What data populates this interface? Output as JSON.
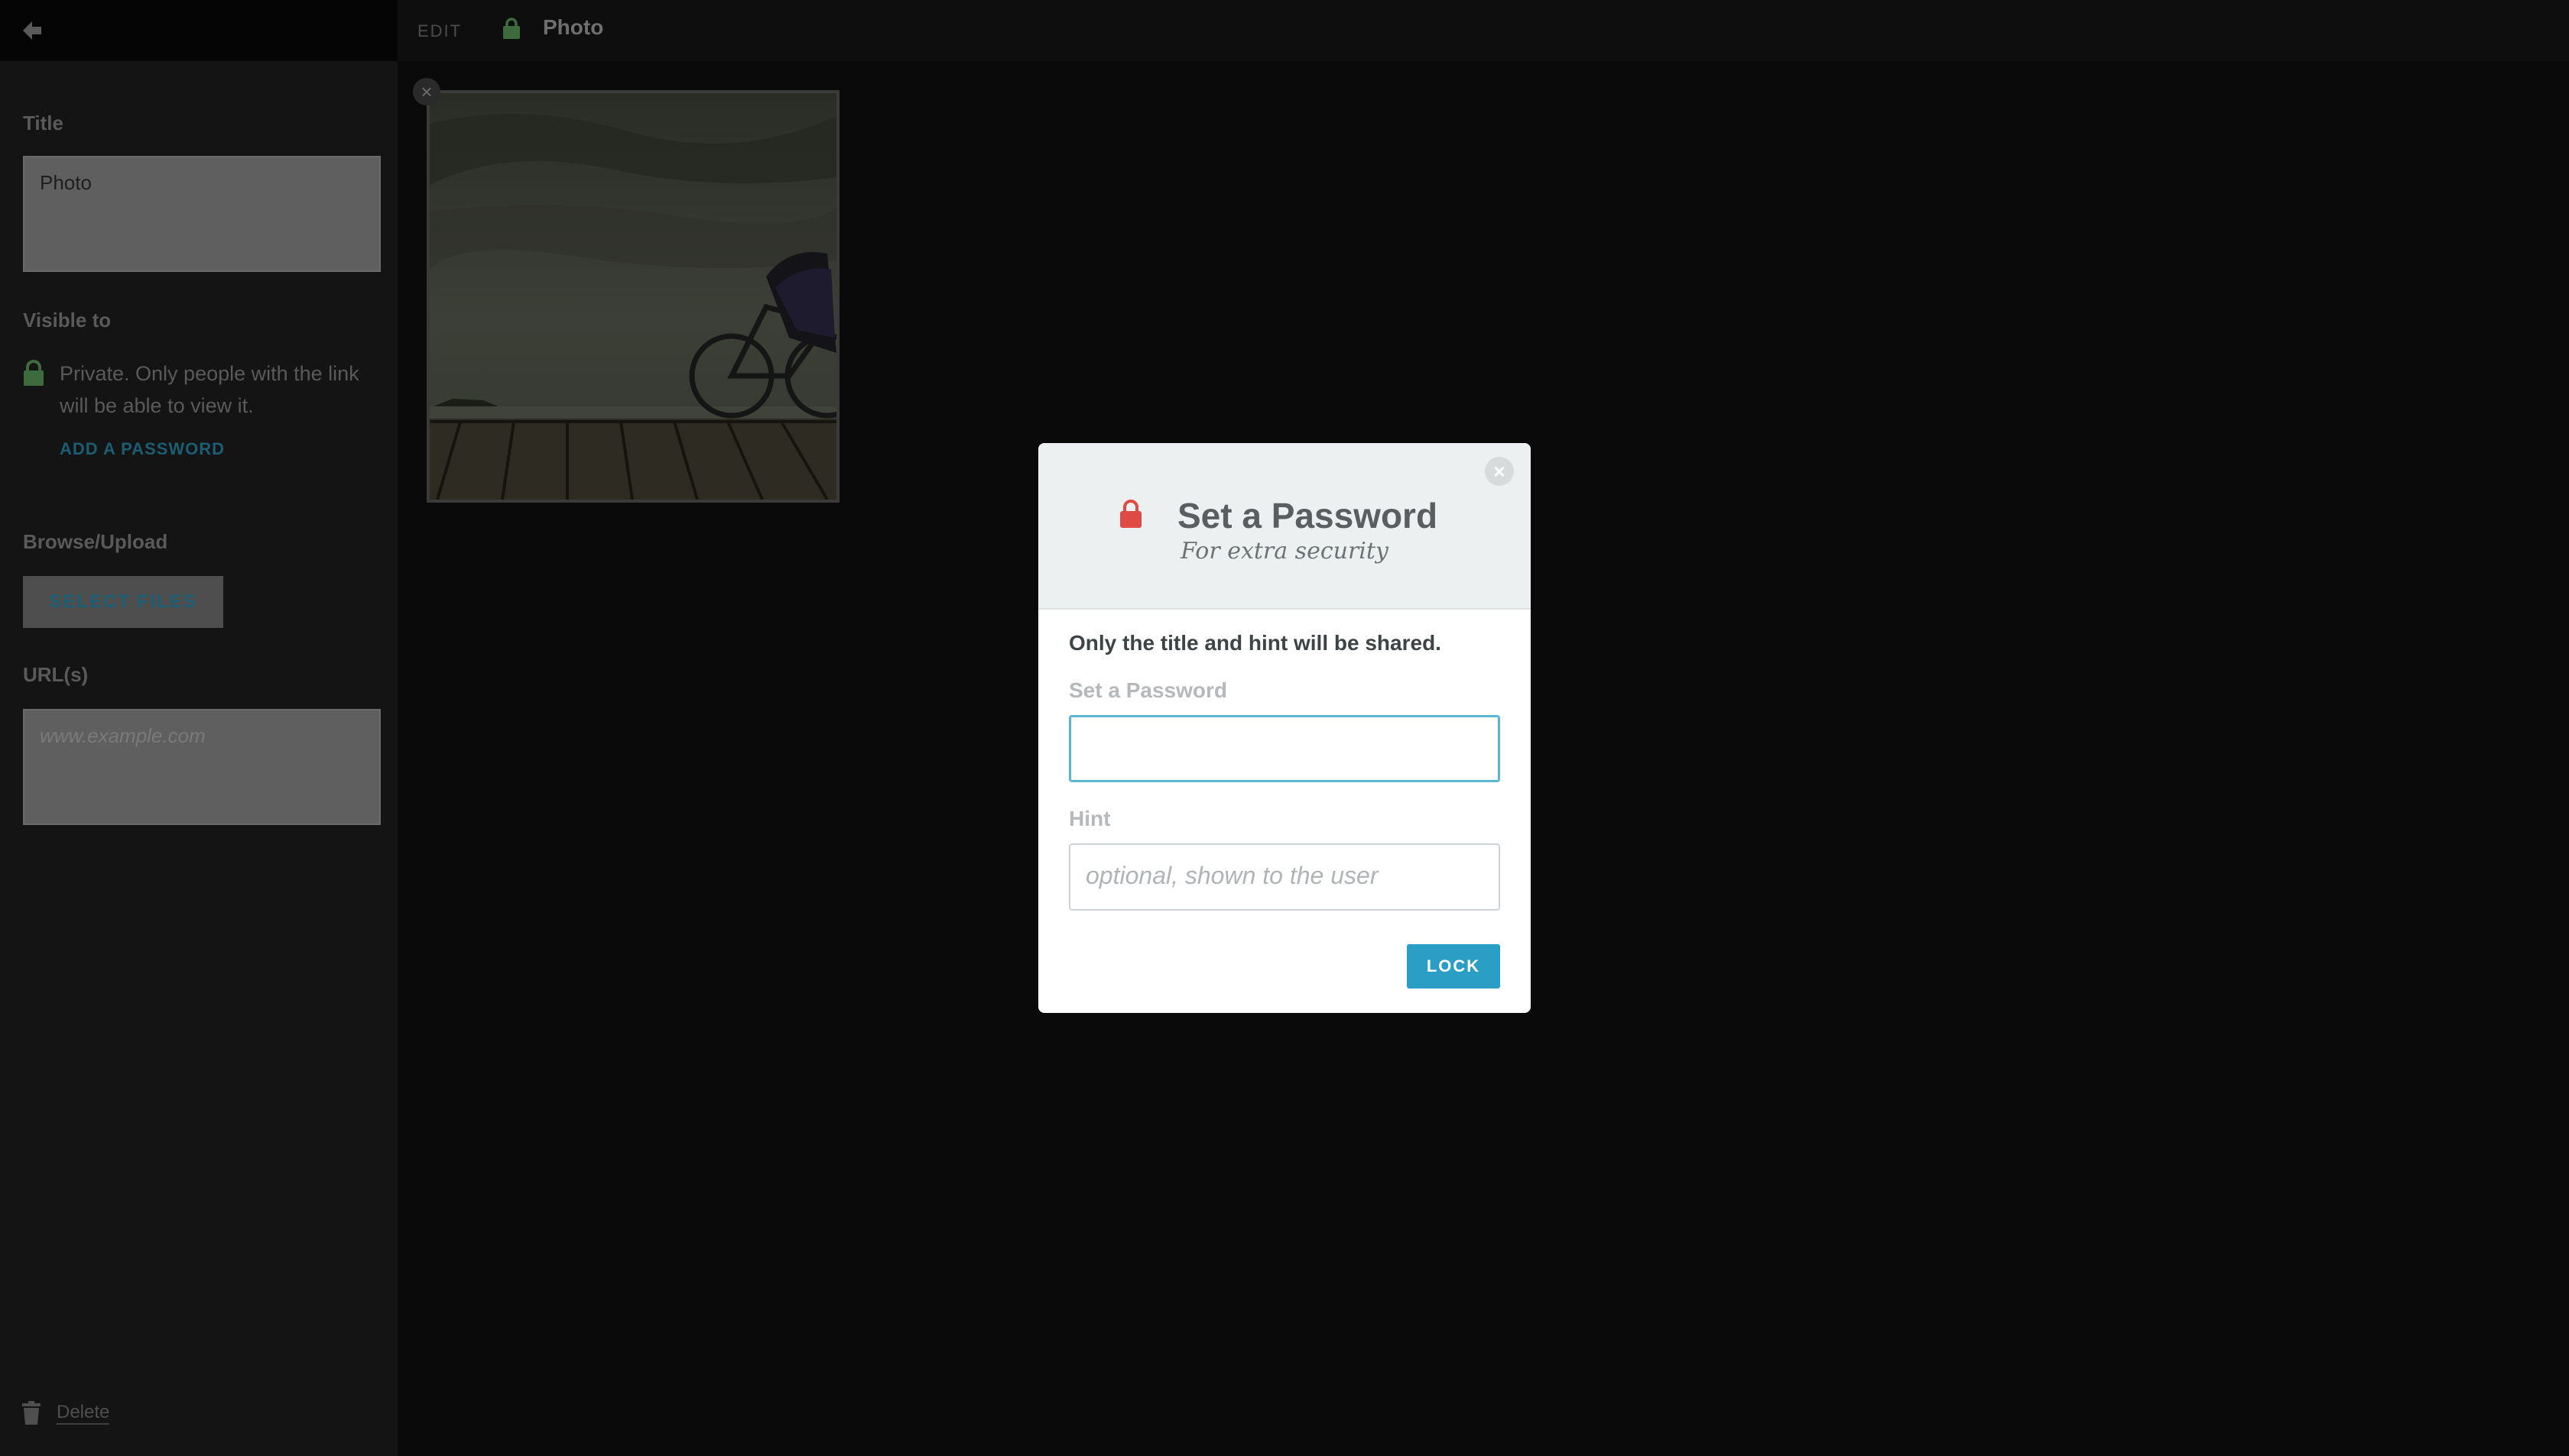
{
  "sidebar": {
    "title_label": "Title",
    "title_value": "Photo",
    "visible_label": "Visible to",
    "visibility_text": "Private. Only people with the link will be able to view it.",
    "add_password": "ADD A PASSWORD",
    "browse_label": "Browse/Upload",
    "select_files": "SELECT FILES",
    "urls_label": "URL(s)",
    "urls_placeholder": "www.example.com",
    "delete_label": "Delete"
  },
  "topbar": {
    "edit_label": "EDIT",
    "title": "Photo"
  },
  "photo": {
    "close_icon": "×"
  },
  "modal": {
    "close_icon": "×",
    "title": "Set a Password",
    "subtitle": "For extra security",
    "note": "Only the title and hint will be shared.",
    "password_label": "Set a Password",
    "password_value": "",
    "hint_label": "Hint",
    "hint_placeholder": "optional, shown to the user",
    "lock_button": "LOCK"
  },
  "colors": {
    "accent": "#2a9ec4",
    "lock_red": "#e04a45",
    "lock_green": "#3d6b3d"
  },
  "icons": {
    "back": "back-arrow-icon",
    "lock": "lock-icon",
    "trash": "trash-icon",
    "close": "close-icon"
  }
}
